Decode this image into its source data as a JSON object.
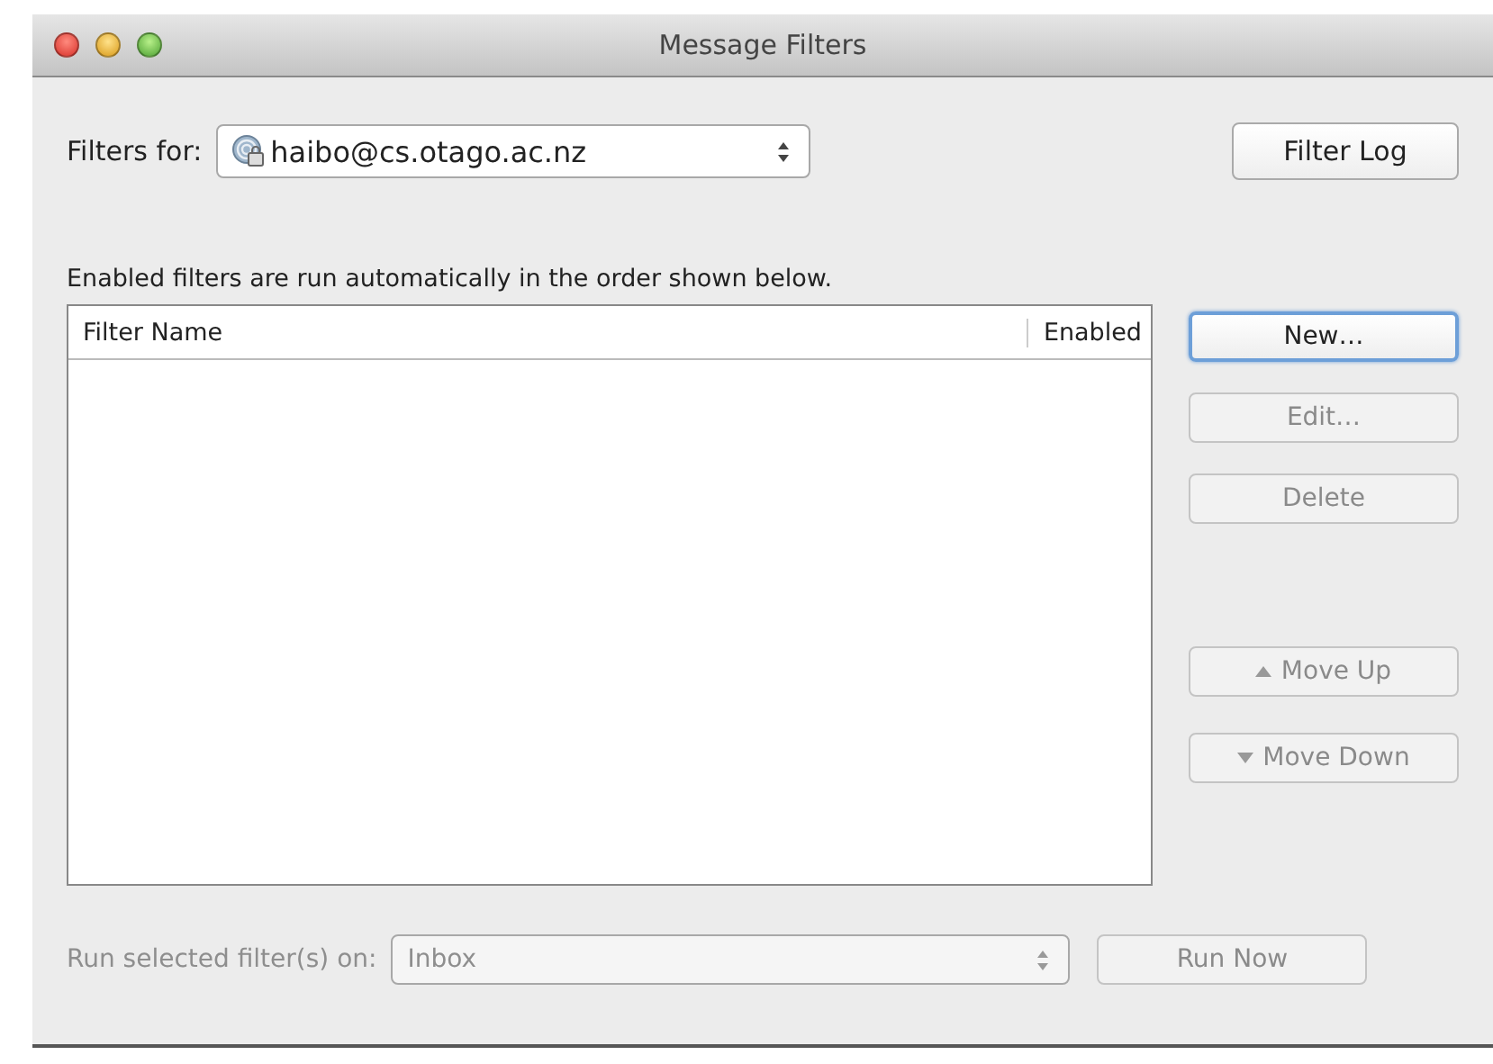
{
  "window": {
    "title": "Message Filters"
  },
  "filters_for": {
    "label": "Filters for:",
    "account": "haibo@cs.otago.ac.nz"
  },
  "filter_log_button": {
    "label": "Filter Log",
    "disabled": false
  },
  "hint": "Enabled filters are run automatically in the order shown below.",
  "table": {
    "columns": [
      "Filter Name",
      "Enabled"
    ]
  },
  "side_buttons": [
    {
      "label": "New…",
      "disabled": false,
      "default": true,
      "kind": "plain"
    },
    {
      "label": "Edit…",
      "disabled": true,
      "default": false,
      "kind": "plain"
    },
    {
      "label": "Delete",
      "disabled": true,
      "default": false,
      "kind": "plain"
    },
    {
      "label": "Move Up",
      "disabled": true,
      "default": false,
      "kind": "up"
    },
    {
      "label": "Move Down",
      "disabled": true,
      "default": false,
      "kind": "down"
    }
  ],
  "run": {
    "label": "Run selected filter(s) on:",
    "folder": "Inbox",
    "disabled": true,
    "button": "Run Now"
  }
}
